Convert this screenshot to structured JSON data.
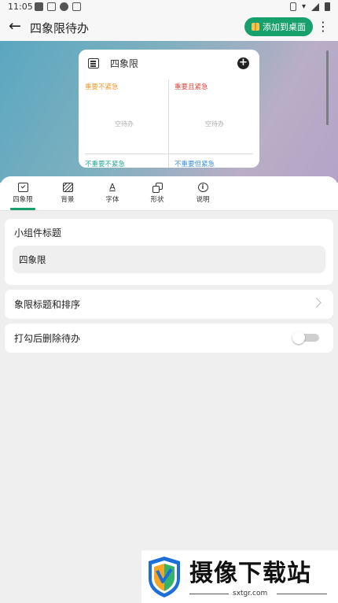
{
  "status_bar": {
    "time": "11:05"
  },
  "header": {
    "title": "四象限待办",
    "add_button_label": "添加到桌面",
    "back_glyph": "←",
    "more_glyph": "⋮"
  },
  "widget_preview": {
    "title": "四象限",
    "add_glyph": "+",
    "quadrants": {
      "top_left": "重要不紧急",
      "top_right": "重要且紧急",
      "bottom_left": "不重要不紧急",
      "bottom_right": "不重要但紧急"
    },
    "empty_text": "空待办",
    "colors": {
      "top_left": "#f29a2e",
      "top_right": "#e0463d",
      "bottom_left": "#26a69a",
      "bottom_right": "#3e8fe0"
    }
  },
  "tabs": [
    {
      "label": "四象限",
      "icon": "calendar-check-icon",
      "glyph": ""
    },
    {
      "label": "背景",
      "icon": "background-icon",
      "glyph": ""
    },
    {
      "label": "字体",
      "icon": "font-icon",
      "glyph": "A"
    },
    {
      "label": "形状",
      "icon": "shape-icon",
      "glyph": ""
    },
    {
      "label": "说明",
      "icon": "info-icon",
      "glyph": "i"
    }
  ],
  "active_tab": "四象限",
  "accent_color": "#17a06c",
  "settings": {
    "widget_title_label": "小组件标题",
    "widget_title_value": "四象限",
    "quadrant_sort_label": "象限标题和排序",
    "delete_after_check_label": "打勾后删除待办",
    "delete_after_check_enabled": false
  },
  "watermark": {
    "title": "摄像下载站",
    "url": "sxtgr.com"
  }
}
